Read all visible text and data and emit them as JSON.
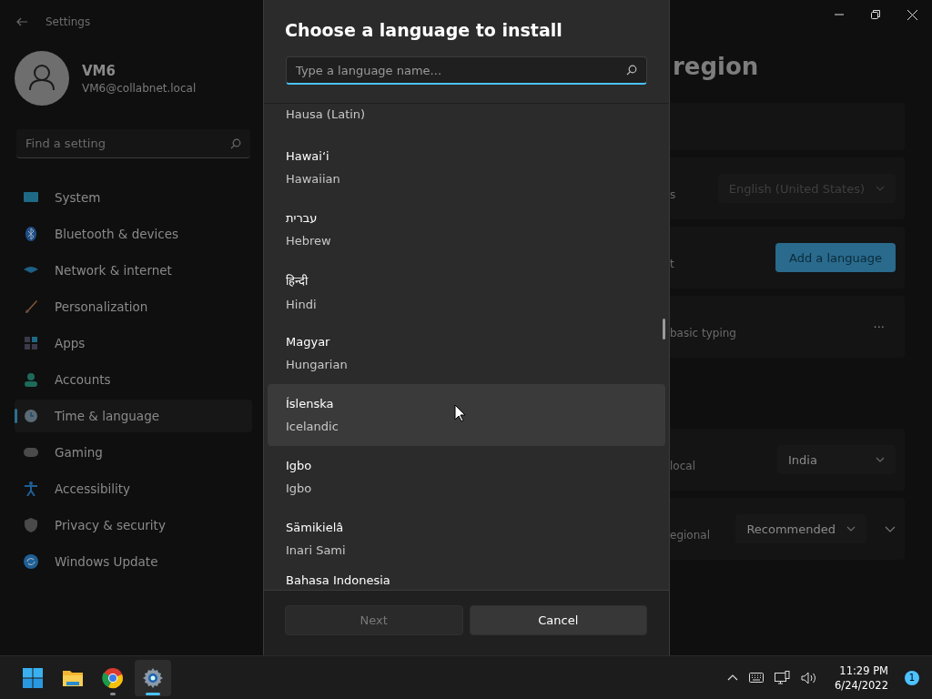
{
  "window": {
    "title": "Settings"
  },
  "account": {
    "name": "VM6",
    "email": "VM6@collabnet.local"
  },
  "search": {
    "placeholder": "Find a setting"
  },
  "nav": [
    {
      "label": "System",
      "selected": false
    },
    {
      "label": "Bluetooth & devices",
      "selected": false
    },
    {
      "label": "Network & internet",
      "selected": false
    },
    {
      "label": "Personalization",
      "selected": false
    },
    {
      "label": "Apps",
      "selected": false
    },
    {
      "label": "Accounts",
      "selected": false
    },
    {
      "label": "Time & language",
      "selected": true
    },
    {
      "label": "Gaming",
      "selected": false
    },
    {
      "label": "Accessibility",
      "selected": false
    },
    {
      "label": "Privacy & security",
      "selected": false
    },
    {
      "label": "Windows Update",
      "selected": false
    }
  ],
  "page": {
    "title": "region",
    "cards": [
      {
        "label": "s",
        "control": {
          "kind": "dropdown",
          "value": "English (United States)",
          "disabled": true
        }
      },
      {
        "label": "t",
        "control": {
          "kind": "button",
          "value": "Add a language"
        }
      },
      {
        "label": "basic typing",
        "control": {
          "kind": "more",
          "value": "···"
        }
      },
      {
        "label": "local",
        "control": {
          "kind": "dropdown",
          "value": "India"
        }
      },
      {
        "label": "egional",
        "control": {
          "kind": "dropdown",
          "value": "Recommended",
          "expand": true
        }
      }
    ]
  },
  "dialog": {
    "title": "Choose a language to install",
    "search_placeholder": "Type a language name...",
    "languages": [
      {
        "english": "Hausa (Latin)",
        "hovered": false
      },
      {
        "native": "Hawaiʻi",
        "english": "Hawaiian",
        "hovered": false
      },
      {
        "native": "עברית",
        "english": "Hebrew",
        "hovered": false
      },
      {
        "native": "हिन्दी",
        "english": "Hindi",
        "hovered": false
      },
      {
        "native": "Magyar",
        "english": "Hungarian",
        "hovered": false
      },
      {
        "native": "Íslenska",
        "english": "Icelandic",
        "hovered": true
      },
      {
        "native": "Igbo",
        "english": "Igbo",
        "hovered": false
      },
      {
        "native": "Sämikielâ",
        "english": "Inari Sami",
        "hovered": false
      },
      {
        "native": "Bahasa Indonesia",
        "hovered": false
      }
    ],
    "buttons": [
      {
        "label": "Next",
        "disabled": true
      },
      {
        "label": "Cancel",
        "disabled": false
      }
    ]
  },
  "taskbar": {
    "apps": [
      {
        "kind": "start",
        "active": false
      },
      {
        "kind": "folder",
        "active": false
      },
      {
        "kind": "browser",
        "active": false,
        "running": true
      },
      {
        "kind": "settings",
        "active": true,
        "running": true
      }
    ],
    "time": "11:29 PM",
    "date": "6/24/2022",
    "notifications": "1"
  }
}
